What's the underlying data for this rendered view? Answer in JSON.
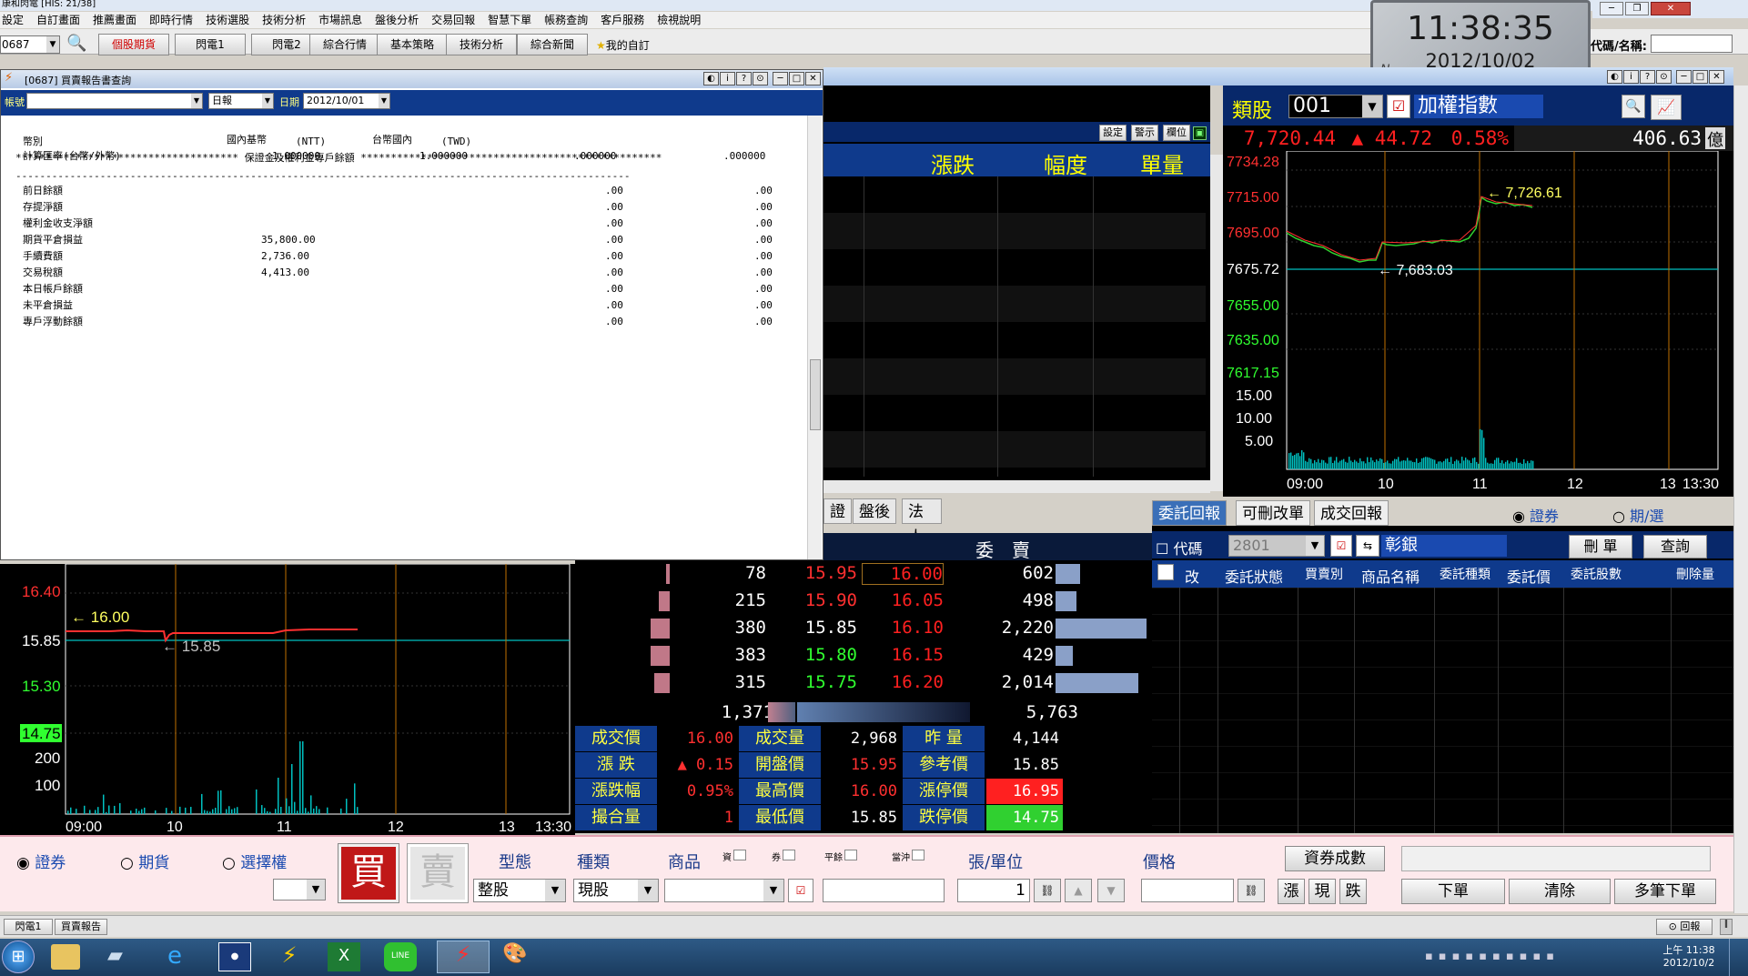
{
  "app": {
    "title": "康和閃電 [HIS: 21/38]"
  },
  "menu": [
    "設定",
    "自訂畫面",
    "推薦畫面",
    "即時行情",
    "技術選股",
    "技術分析",
    "市場訊息",
    "盤後分析",
    "交易回報",
    "智慧下單",
    "帳務查詢",
    "客戶服務",
    "檢視說明"
  ],
  "toolbar": {
    "symbol": "0687",
    "buttons": [
      "個股期貨",
      "閃電1",
      "閃電2",
      "綜合行情",
      "基本策略",
      "技術分析",
      "綜合新聞"
    ],
    "favorite": "我的自訂",
    "code_label": "代碼/名稱:"
  },
  "clock": {
    "time": "11:38:35",
    "date": "2012/10/02"
  },
  "report": {
    "title": "[0687] 買賣報告書查詢",
    "account_label": "帳號",
    "period": "日報",
    "date_label": "日期",
    "date": "2012/10/01",
    "heading": "************************************* 保證金及權利金專戶餘額 **************************************************",
    "col_currency": "幣別",
    "col_base": "國內基幣",
    "col_ntt": "(NTT)",
    "col_twd_label": "台幣國內",
    "col_twd": "(TWD)",
    "rate_label": "計算匯率(台幣/外幣)",
    "rate_vals": [
      "1.000000",
      "1.000000",
      ".000000",
      ".000000"
    ],
    "divider": "------------------------------------------------------------------------------------------------------",
    "rows": [
      {
        "label": "前日餘額",
        "base": "",
        "v1": ".00",
        "v2": ".00"
      },
      {
        "label": "存提淨額",
        "base": "",
        "v1": ".00",
        "v2": ".00"
      },
      {
        "label": "權利金收支淨額",
        "base": "",
        "v1": ".00",
        "v2": ".00"
      },
      {
        "label": "期貨平倉損益",
        "base": "35,800.00",
        "v1": ".00",
        "v2": ".00"
      },
      {
        "label": "手續費額",
        "base": "2,736.00",
        "v1": ".00",
        "v2": ".00"
      },
      {
        "label": "交易稅額",
        "base": "4,413.00",
        "v1": ".00",
        "v2": ".00"
      },
      {
        "label": "本日帳戶餘額",
        "base": "",
        "v1": ".00",
        "v2": ".00"
      },
      {
        "label": "未平倉損益",
        "base": "",
        "v1": ".00",
        "v2": ".00"
      },
      {
        "label": "專戶浮動餘額",
        "base": "",
        "v1": ".00",
        "v2": ".00"
      }
    ]
  },
  "quote_list": {
    "buttons": [
      "設定",
      "警示",
      "欄位"
    ],
    "headers": [
      "漲跌",
      "幅度",
      "單量"
    ],
    "tabs": [
      "證",
      "盤後",
      "法人"
    ]
  },
  "index_panel": {
    "group_label": "類股",
    "group_code": "001",
    "index_name": "加權指數",
    "last": "7,720.44",
    "change": "44.72",
    "pct": "0.58%",
    "volume": "406.63",
    "volume_unit": "億",
    "y_labels": [
      "7734.28",
      "7715.00",
      "7695.00",
      "7675.72",
      "7655.00",
      "7635.00",
      "7617.15"
    ],
    "vol_labels": [
      "15.00",
      "10.00",
      "5.00"
    ],
    "x_labels": [
      "09:00",
      "10",
      "11",
      "12",
      "13",
      "13:30"
    ],
    "high_note": "7,726.61",
    "low_note": "7,683.03",
    "bg": "#000000",
    "ref_color": "#00c0c0"
  },
  "stock_chart": {
    "y_labels": [
      "16.40",
      "15.85",
      "15.30",
      "14.75"
    ],
    "vol_labels": [
      "200",
      "100"
    ],
    "x_labels": [
      "09:00",
      "10",
      "11",
      "12",
      "13",
      "13:30"
    ],
    "high_note": "16.00",
    "low_note": "15.85"
  },
  "orderbook": {
    "sell_label": "委　賣",
    "bids": [
      {
        "qty": "78",
        "bid": "15.95",
        "ask": "16.00",
        "aqty": "602"
      },
      {
        "qty": "215",
        "bid": "15.90",
        "ask": "16.05",
        "aqty": "498"
      },
      {
        "qty": "380",
        "bid": "15.85",
        "ask": "16.10",
        "aqty": "2,220"
      },
      {
        "qty": "383",
        "bid": "15.80",
        "ask": "16.15",
        "aqty": "429"
      },
      {
        "qty": "315",
        "bid": "15.75",
        "ask": "16.20",
        "aqty": "2,014"
      }
    ],
    "total_bid": "1,371",
    "total_ask": "5,763",
    "stats": [
      [
        "成交價",
        "16.00",
        "成交量",
        "2,968",
        "昨 量",
        "4,144"
      ],
      [
        "漲 跌",
        "0.15",
        "開盤價",
        "15.95",
        "參考價",
        "15.85"
      ],
      [
        "漲跌幅",
        "0.95%",
        "最高價",
        "16.00",
        "漲停價",
        "16.95"
      ],
      [
        "撮合量",
        "1",
        "最低價",
        "15.85",
        "跌停價",
        "14.75"
      ]
    ]
  },
  "orders": {
    "tabs": [
      "委託回報",
      "可刪改單",
      "成交回報"
    ],
    "radio": [
      "證券",
      "期/選"
    ],
    "code_label": "代碼",
    "code": "2801",
    "name": "彰銀",
    "buttons": [
      "刪 單",
      "查詢"
    ],
    "headers": [
      "改",
      "委託狀態",
      "買賣別",
      "商品名稱",
      "委託種類",
      "委託價",
      "委託股數",
      "刪除量"
    ]
  },
  "order_entry": {
    "radios": [
      "證券",
      "期貨",
      "選擇權"
    ],
    "buy": "買",
    "sell": "賣",
    "labels": [
      "型態",
      "種類",
      "商品",
      "張/單位",
      "價格"
    ],
    "type": "整股",
    "kind": "現股",
    "mini_labels": [
      "資",
      "券",
      "平餘",
      "當沖"
    ],
    "qty": "1",
    "right_buttons": [
      "資券成數",
      "下單",
      "清除",
      "多筆下單"
    ],
    "price_buttons": [
      "漲",
      "現",
      "跌"
    ]
  },
  "statusbar": {
    "tabs": [
      "閃電1",
      "買賣報告"
    ],
    "right": "回報"
  },
  "taskbar": {
    "time": "上午 11:38",
    "date": "2012/10/2"
  }
}
